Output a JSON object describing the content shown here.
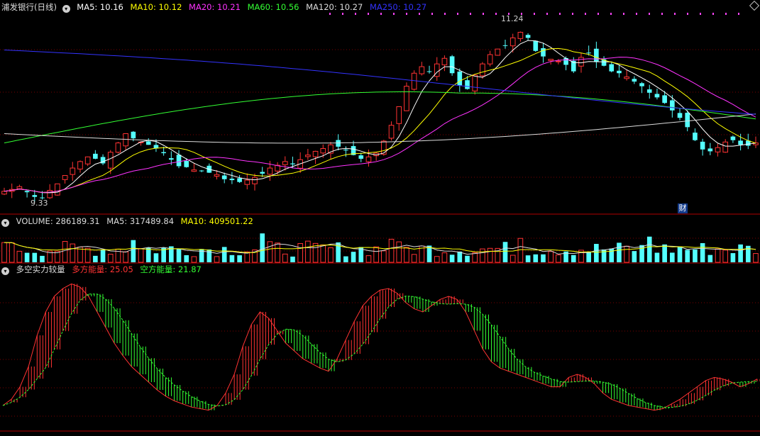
{
  "price_panel": {
    "title": "浦发银行(日线)",
    "legend": [
      {
        "name": "MA5",
        "label": "MA5: 10.16",
        "color": "#ffffff"
      },
      {
        "name": "MA10",
        "label": "MA10: 10.12",
        "color": "#ffff00"
      },
      {
        "name": "MA20",
        "label": "MA20: 10.21",
        "color": "#ff33ff"
      },
      {
        "name": "MA60",
        "label": "MA60: 10.56",
        "color": "#33ff33"
      },
      {
        "name": "MA120",
        "label": "MA120: 10.27",
        "color": "#dcdcdc"
      },
      {
        "name": "MA250",
        "label": "MA250: 10.27",
        "color": "#3333ff"
      }
    ],
    "high_label": "11.24",
    "low_label": "9.33",
    "finance_badge": "财"
  },
  "volume_panel": {
    "legend": [
      {
        "name": "VOLUME",
        "label": "VOLUME: 286189.31",
        "color": "#dcdcdc"
      },
      {
        "name": "MA5",
        "label": "MA5: 317489.84",
        "color": "#dcdcdc"
      },
      {
        "name": "MA10",
        "label": "MA10: 409501.22",
        "color": "#ffff00"
      }
    ]
  },
  "indicator_panel": {
    "title": "多空实力较量",
    "legend": [
      {
        "name": "多方能量",
        "label": "多方能量: 25.05",
        "color": "#ff3333"
      },
      {
        "name": "空方能量",
        "label": "空方能量: 21.87",
        "color": "#33ff33"
      }
    ]
  },
  "colors": {
    "up": "#ff3333",
    "down": "#54ffff",
    "background": "#000000",
    "grid": "#7a0000",
    "separator": "#b00000"
  },
  "chart_data": [
    {
      "type": "candlestick",
      "title": "浦发银行(日线)",
      "x_count": 120,
      "ylim": [
        9.2,
        11.35
      ],
      "annotations": [
        {
          "label": "11.24",
          "value": 11.24
        },
        {
          "label": "9.33",
          "value": 9.33
        }
      ],
      "close": [
        9.43,
        9.45,
        9.48,
        9.42,
        9.37,
        9.36,
        9.44,
        9.51,
        9.6,
        9.68,
        9.75,
        9.8,
        9.78,
        9.73,
        9.85,
        9.95,
        10.05,
        10.0,
        9.96,
        9.93,
        9.89,
        9.84,
        9.77,
        9.7,
        9.69,
        9.66,
        9.65,
        9.63,
        9.61,
        9.56,
        9.55,
        9.53,
        9.55,
        9.58,
        9.62,
        9.68,
        9.71,
        9.75,
        9.72,
        9.77,
        9.82,
        9.86,
        9.89,
        9.93,
        9.91,
        9.87,
        9.82,
        9.78,
        9.8,
        9.84,
        9.97,
        10.14,
        10.34,
        10.56,
        10.7,
        10.77,
        10.72,
        10.8,
        10.86,
        10.7,
        10.57,
        10.53,
        10.68,
        10.8,
        10.9,
        10.96,
        11.0,
        11.08,
        11.14,
        11.08,
        10.94,
        10.88,
        10.85,
        10.83,
        10.79,
        10.72,
        10.87,
        10.92,
        10.82,
        10.78,
        10.72,
        10.7,
        10.66,
        10.61,
        10.56,
        10.49,
        10.44,
        10.38,
        10.3,
        10.22,
        10.12,
        9.98,
        9.88,
        9.86,
        9.9,
        9.96,
        9.98,
        9.93,
        9.92,
        9.95
      ],
      "moving_averages": [
        {
          "name": "MA5",
          "last": 10.16
        },
        {
          "name": "MA10",
          "last": 10.12
        },
        {
          "name": "MA20",
          "last": 10.21
        },
        {
          "name": "MA60",
          "last": 10.56
        },
        {
          "name": "MA120",
          "last": 10.27
        },
        {
          "name": "MA250",
          "last": 10.27
        }
      ]
    },
    {
      "type": "bar",
      "title": "VOLUME",
      "values_last": [
        286189.31
      ],
      "ma5_last": 317489.84,
      "ma10_last": 409501.22
    },
    {
      "type": "bar",
      "title": "多空实力较量",
      "series": [
        {
          "name": "多方能量",
          "last": 25.05
        },
        {
          "name": "空方能量",
          "last": 21.87
        }
      ],
      "energy": [
        10,
        14,
        22,
        35,
        55,
        70,
        80,
        85,
        88,
        86,
        80,
        70,
        60,
        50,
        42,
        35,
        30,
        25,
        20,
        16,
        13,
        11,
        9,
        8,
        7,
        10,
        18,
        30,
        48,
        62,
        70,
        66,
        58,
        50,
        45,
        40,
        37,
        34,
        32,
        40,
        52,
        64,
        74,
        80,
        84,
        85,
        82,
        76,
        72,
        70,
        74,
        78,
        80,
        78,
        70,
        58,
        46,
        38,
        34,
        32,
        30,
        28,
        26,
        24,
        22,
        22,
        28,
        30,
        28,
        24,
        18,
        14,
        12,
        10,
        9,
        8,
        7,
        8,
        11,
        14,
        18,
        22,
        26,
        28,
        27,
        25,
        22,
        24,
        27
      ]
    }
  ]
}
